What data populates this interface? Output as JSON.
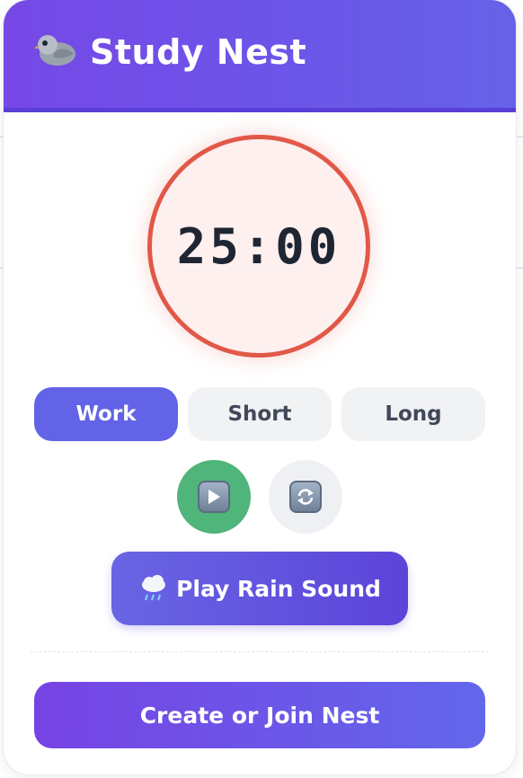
{
  "header": {
    "title": "Study Nest",
    "logo_icon": "pigeon-icon",
    "gradient": [
      "#7648e6",
      "#6662e8"
    ]
  },
  "timer": {
    "display": "25:00",
    "ring_color": "#e25848"
  },
  "modes": [
    {
      "label": "Work",
      "active": true
    },
    {
      "label": "Short",
      "active": false
    },
    {
      "label": "Long",
      "active": false
    }
  ],
  "controls": {
    "play_icon": "play-icon",
    "reset_icon": "refresh-icon"
  },
  "rain_button": {
    "label": "Play Rain Sound",
    "icon": "rain-cloud-icon"
  },
  "nest_button": {
    "label": "Create or Join Nest"
  },
  "colors": {
    "accent": "#6263e6",
    "play": "#4fb57a",
    "text_dark": "#1f2633"
  }
}
